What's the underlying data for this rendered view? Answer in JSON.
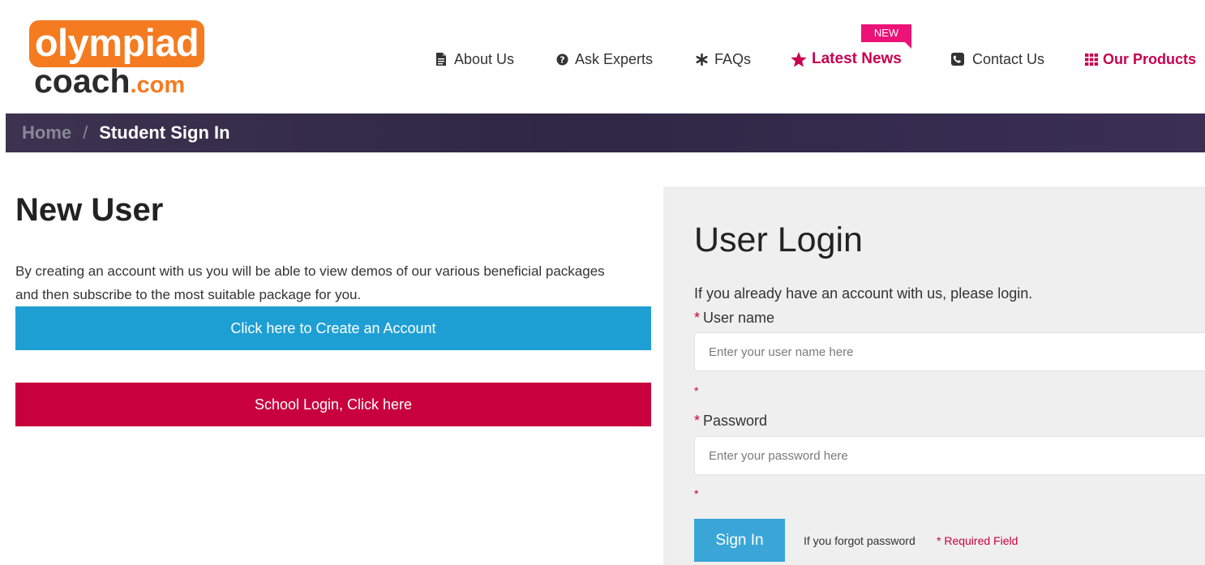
{
  "logo": {
    "top": "olympiad",
    "bottom": "coach",
    "suffix": ".com"
  },
  "nav": {
    "items": [
      {
        "label": "About Us",
        "icon": "document-icon"
      },
      {
        "label": "Ask Experts",
        "icon": "question-circle-icon"
      },
      {
        "label": "FAQs",
        "icon": "asterisk-icon"
      },
      {
        "label": "Latest News",
        "icon": "star-icon"
      },
      {
        "label": "Contact Us",
        "icon": "phone-square-icon"
      },
      {
        "label": "Our Products",
        "icon": "grid-icon"
      }
    ],
    "badge": "NEW"
  },
  "breadcrumb": {
    "home": "Home",
    "separator": "/",
    "current": "Student Sign In"
  },
  "new_user": {
    "title": "New User",
    "description": "By creating an account with us you will be able to view demos of our various beneficial packages and then subscribe to the most suitable package for you.",
    "create_button": "Click here to Create an Account",
    "school_button": "School Login, Click here"
  },
  "login": {
    "title": "User Login",
    "intro": "If you already have an account with us, please login.",
    "required_marker": "*",
    "username_label": "User name",
    "username_placeholder": "Enter your user name here",
    "password_label": "Password",
    "password_placeholder": "Enter your password here",
    "signin_button": "Sign In",
    "forgot_link": "If you forgot password",
    "required_note": "* Required Field"
  },
  "colors": {
    "brand_orange": "#f47b20",
    "accent_magenta": "#c8004f",
    "breadcrumb_bg": "#2f2745",
    "create_button": "#1e9fd4",
    "school_button": "#c8003d",
    "signin_button": "#3aa6d8"
  }
}
